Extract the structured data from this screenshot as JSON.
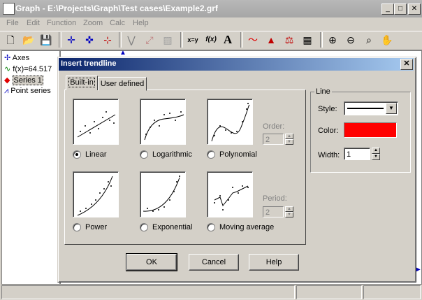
{
  "app": {
    "title": "Graph - E:\\Projects\\Graph\\Test cases\\Example2.grf",
    "menu": [
      "File",
      "Edit",
      "Function",
      "Zoom",
      "Calc",
      "Help"
    ],
    "tree": {
      "axes": "Axes",
      "function": "f(x)=64.517",
      "series": "Series 1",
      "point_series": "Point series"
    },
    "toolbar_text": {
      "xy": "x=y",
      "fx": "f(x)",
      "A": "A"
    },
    "window_buttons": {
      "min": "_",
      "max": "□",
      "close": "✕"
    }
  },
  "dialog": {
    "title": "Insert trendline",
    "close": "✕",
    "tabs": {
      "builtin": "Built-in",
      "user": "User defined"
    },
    "options": {
      "linear": "Linear",
      "logarithmic": "Logarithmic",
      "polynomial": "Polynomial",
      "power": "Power",
      "exponential": "Exponential",
      "moving_average": "Moving average"
    },
    "selected": "linear",
    "order": {
      "label": "Order:",
      "value": "2"
    },
    "period": {
      "label": "Period:",
      "value": "2"
    },
    "line": {
      "group_label": "Line",
      "style_label": "Style:",
      "color_label": "Color:",
      "color_value": "#ff0000",
      "width_label": "Width:",
      "width_value": "1"
    },
    "buttons": {
      "ok": "OK",
      "cancel": "Cancel",
      "help": "Help"
    }
  }
}
